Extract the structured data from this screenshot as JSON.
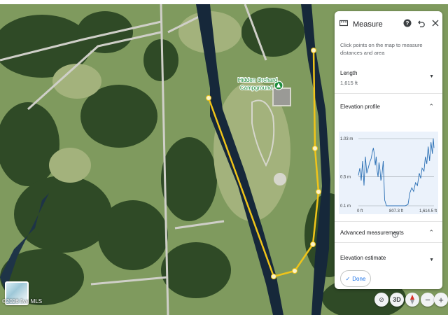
{
  "map": {
    "place_label": [
      "Hidden Orchard",
      "Campground"
    ],
    "copyright": "©2026 five MLS",
    "colors": {
      "path": "#f0c419",
      "water": "#16283a",
      "grass": "#8aa46a",
      "forest": "#2f4a26"
    }
  },
  "panel": {
    "title": "Measure",
    "description": "Click points on the map to measure distances and area",
    "length_label": "Length",
    "length_value": "1,615 ft",
    "elevation_label": "Elevation profile",
    "y_ticks": [
      "1.03 m",
      "0.5 m",
      "0.1 m"
    ],
    "x_ticks": [
      "0 ft",
      "807.3 ft",
      "1,614.5 ft"
    ],
    "advanced_label": "Advanced measurements",
    "estimate_label": "Elevation estimate",
    "done_label": "Done",
    "icons": {
      "ruler": "ruler-icon",
      "help": "help-icon",
      "undo": "undo-icon",
      "close": "close-icon"
    }
  },
  "controls": {
    "view3d": "3D",
    "zoom_in": "+",
    "zoom_out": "−"
  },
  "chart_data": {
    "type": "line",
    "title": "",
    "xlabel": "",
    "ylabel": "",
    "xlim": [
      0,
      1614.5
    ],
    "ylim": [
      0.1,
      1.03
    ],
    "x_tick_labels": [
      "0 ft",
      "807.3 ft",
      "1,614.5 ft"
    ],
    "y_tick_labels": [
      "1.03 m",
      "0.5 m",
      "0.1 m"
    ],
    "series": [
      {
        "x": [
          0,
          30,
          60,
          90,
          120,
          150,
          180,
          210,
          240,
          270,
          300,
          320,
          340,
          360,
          380,
          400,
          420,
          440,
          460,
          480,
          500,
          530,
          560,
          600,
          1000,
          1060,
          1100,
          1140,
          1180,
          1220,
          1260,
          1300,
          1330,
          1360,
          1400,
          1430,
          1460,
          1490,
          1520,
          1550,
          1580,
          1600,
          1614.5
        ],
        "y": [
          0.52,
          0.62,
          0.45,
          0.72,
          0.38,
          0.78,
          0.55,
          0.62,
          0.7,
          0.75,
          0.85,
          0.9,
          0.82,
          0.66,
          0.78,
          0.58,
          0.5,
          0.7,
          0.6,
          0.45,
          0.5,
          0.72,
          0.18,
          0.1,
          0.1,
          0.12,
          0.28,
          0.35,
          0.3,
          0.42,
          0.38,
          0.55,
          0.48,
          0.62,
          0.58,
          0.78,
          0.68,
          0.92,
          0.72,
          0.98,
          0.82,
          1.03,
          0.9
        ]
      }
    ]
  }
}
